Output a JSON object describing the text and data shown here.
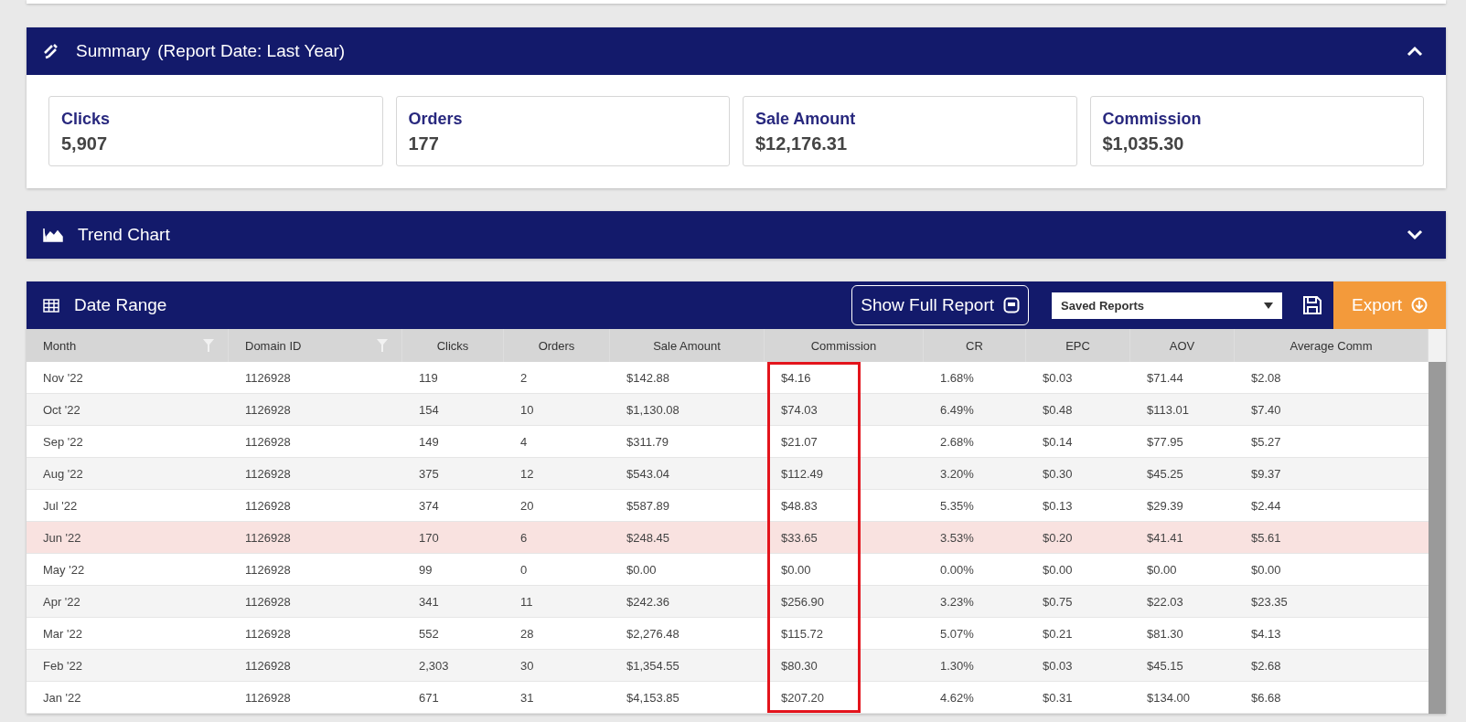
{
  "summary": {
    "title": "Summary",
    "subtitle": "(Report Date: Last Year)",
    "expanded": true,
    "cards": [
      {
        "label": "Clicks",
        "value": "5,907"
      },
      {
        "label": "Orders",
        "value": "177"
      },
      {
        "label": "Sale Amount",
        "value": "$12,176.31"
      },
      {
        "label": "Commission",
        "value": "$1,035.30"
      }
    ]
  },
  "trend_chart": {
    "title": "Trend Chart",
    "expanded": false
  },
  "date_range": {
    "title": "Date Range",
    "show_full_report": "Show Full Report",
    "saved_reports": "Saved Reports",
    "export": "Export",
    "columns": [
      {
        "label": "Month",
        "filter": true,
        "highlighted": false
      },
      {
        "label": "Domain ID",
        "filter": true,
        "highlighted": false
      },
      {
        "label": "Clicks",
        "filter": false,
        "highlighted": false
      },
      {
        "label": "Orders",
        "filter": false,
        "highlighted": false
      },
      {
        "label": "Sale Amount",
        "filter": false,
        "highlighted": false
      },
      {
        "label": "Commission",
        "filter": false,
        "highlighted": true
      },
      {
        "label": "CR",
        "filter": false,
        "highlighted": false
      },
      {
        "label": "EPC",
        "filter": false,
        "highlighted": false
      },
      {
        "label": "AOV",
        "filter": false,
        "highlighted": false
      },
      {
        "label": "Average Comm",
        "filter": false,
        "highlighted": false
      }
    ],
    "rows": [
      {
        "hovered": false,
        "cells": [
          "Nov '22",
          "1126928",
          "119",
          "2",
          "$142.88",
          "$4.16",
          "1.68%",
          "$0.03",
          "$71.44",
          "$2.08"
        ]
      },
      {
        "hovered": false,
        "cells": [
          "Oct '22",
          "1126928",
          "154",
          "10",
          "$1,130.08",
          "$74.03",
          "6.49%",
          "$0.48",
          "$113.01",
          "$7.40"
        ]
      },
      {
        "hovered": false,
        "cells": [
          "Sep '22",
          "1126928",
          "149",
          "4",
          "$311.79",
          "$21.07",
          "2.68%",
          "$0.14",
          "$77.95",
          "$5.27"
        ]
      },
      {
        "hovered": false,
        "cells": [
          "Aug '22",
          "1126928",
          "375",
          "12",
          "$543.04",
          "$112.49",
          "3.20%",
          "$0.30",
          "$45.25",
          "$9.37"
        ]
      },
      {
        "hovered": false,
        "cells": [
          "Jul '22",
          "1126928",
          "374",
          "20",
          "$587.89",
          "$48.83",
          "5.35%",
          "$0.13",
          "$29.39",
          "$2.44"
        ]
      },
      {
        "hovered": true,
        "cells": [
          "Jun '22",
          "1126928",
          "170",
          "6",
          "$248.45",
          "$33.65",
          "3.53%",
          "$0.20",
          "$41.41",
          "$5.61"
        ]
      },
      {
        "hovered": false,
        "cells": [
          "May '22",
          "1126928",
          "99",
          "0",
          "$0.00",
          "$0.00",
          "0.00%",
          "$0.00",
          "$0.00",
          "$0.00"
        ]
      },
      {
        "hovered": false,
        "cells": [
          "Apr '22",
          "1126928",
          "341",
          "11",
          "$242.36",
          "$256.90",
          "3.23%",
          "$0.75",
          "$22.03",
          "$23.35"
        ]
      },
      {
        "hovered": false,
        "cells": [
          "Mar '22",
          "1126928",
          "552",
          "28",
          "$2,276.48",
          "$115.72",
          "5.07%",
          "$0.21",
          "$81.30",
          "$4.13"
        ]
      },
      {
        "hovered": false,
        "cells": [
          "Feb '22",
          "1126928",
          "2,303",
          "30",
          "$1,354.55",
          "$80.30",
          "1.30%",
          "$0.03",
          "$45.15",
          "$2.68"
        ]
      },
      {
        "hovered": false,
        "cells": [
          "Jan '22",
          "1126928",
          "671",
          "31",
          "$4,153.85",
          "$207.20",
          "4.62%",
          "$0.31",
          "$134.00",
          "$6.68"
        ]
      }
    ]
  }
}
